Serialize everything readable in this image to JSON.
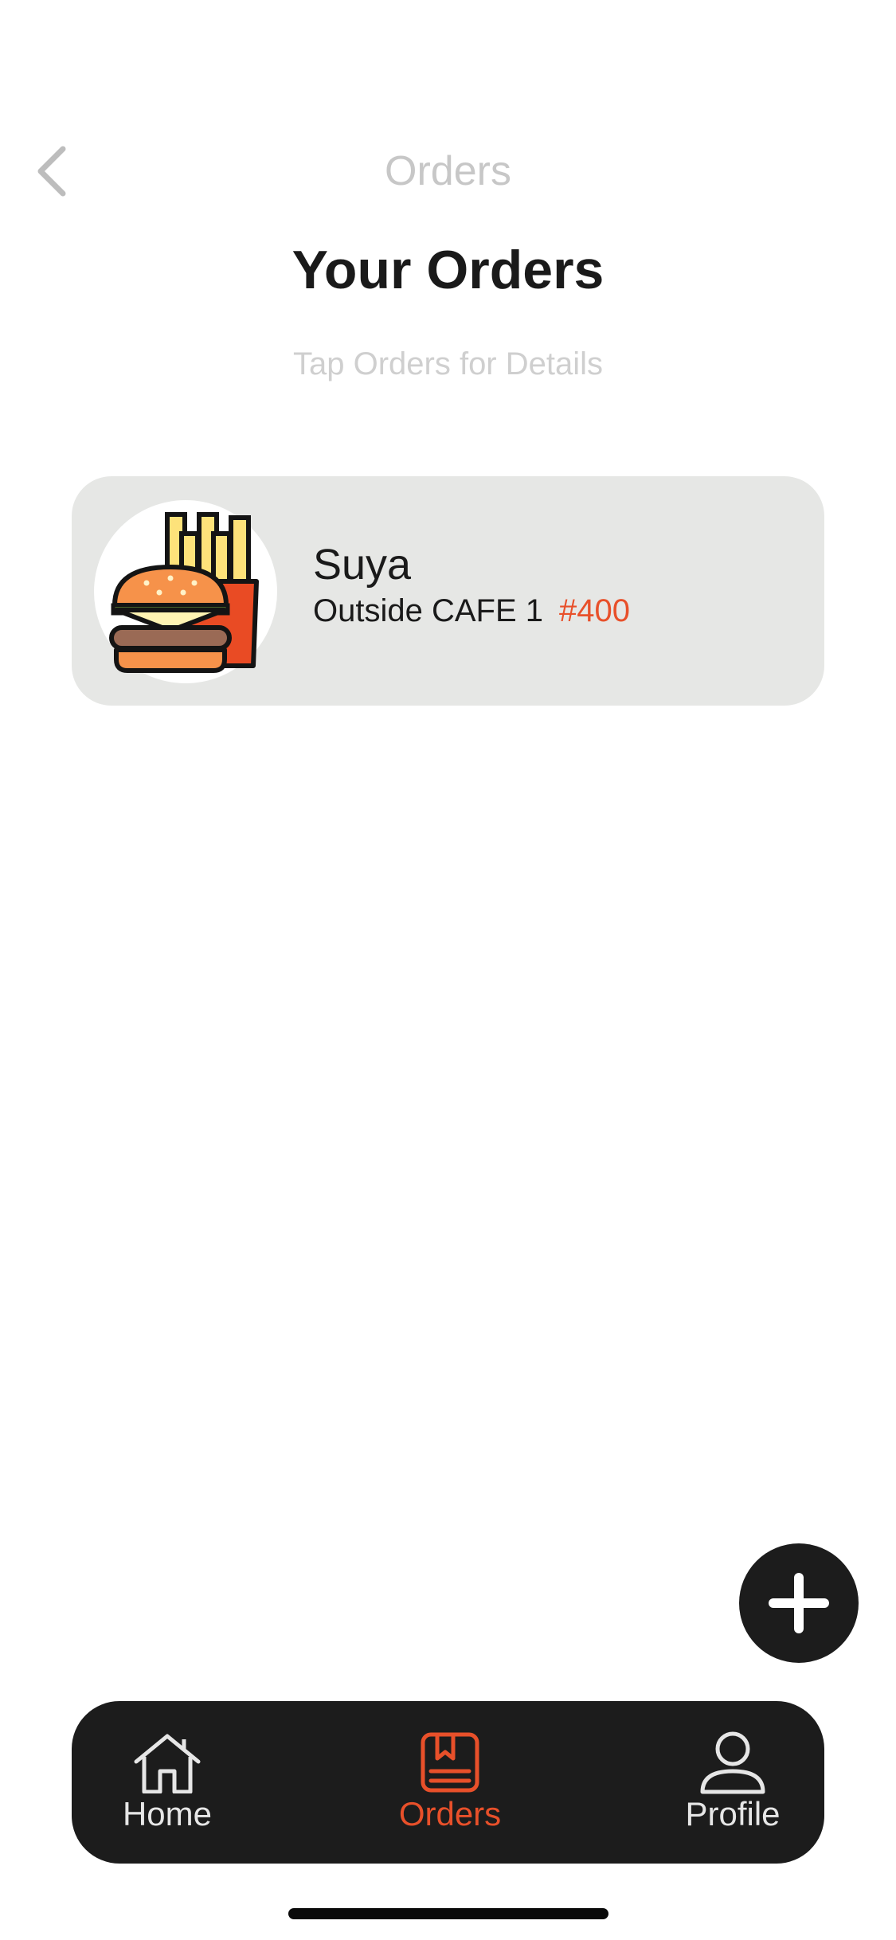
{
  "nav": {
    "back_icon": "chevron-left-icon",
    "title": "Orders"
  },
  "header": {
    "title": "Your Orders",
    "subtitle": "Tap Orders for Details"
  },
  "orders": [
    {
      "name": "Suya",
      "location": "Outside CAFE 1",
      "price": "#400",
      "thumbnail_icon": "burger-fries-icon"
    }
  ],
  "fab": {
    "icon": "plus-icon"
  },
  "tab_bar": {
    "active": "Orders",
    "items": [
      {
        "label": "Home",
        "icon": "home-icon"
      },
      {
        "label": "Orders",
        "icon": "orders-icon"
      },
      {
        "label": "Profile",
        "icon": "profile-icon"
      }
    ]
  },
  "colors": {
    "accent": "#e8502a",
    "card_bg": "#e6e7e5",
    "dark": "#1c1c1c",
    "muted_text": "#c7c7c7"
  }
}
